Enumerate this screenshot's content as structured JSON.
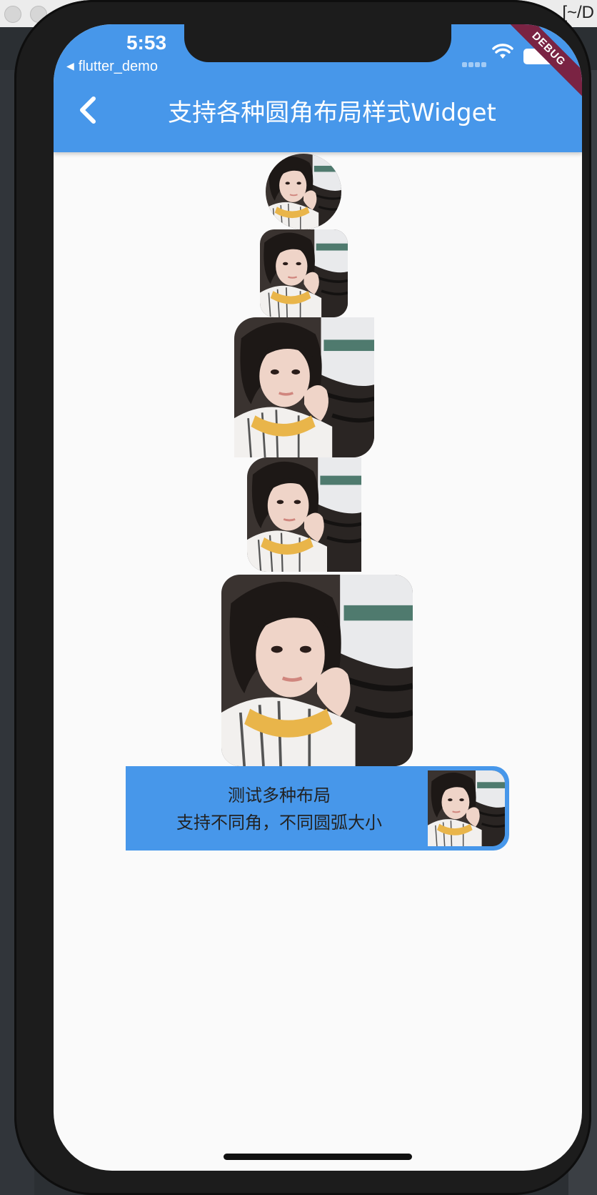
{
  "device": {
    "status_time": "5:53",
    "back_to_app": "flutter_demo",
    "debug_banner": "DEBUG"
  },
  "desktop": {
    "title_fragment": "[~/D"
  },
  "app_bar": {
    "title": "支持各种圆角布局样式Widget",
    "background": "#4797ea",
    "back_icon": "chevron-left-icon"
  },
  "photos": [
    {
      "shape": "circle"
    },
    {
      "shape": "rounded-all"
    },
    {
      "shape": "rounded-top-left-bottom-right"
    },
    {
      "shape": "rounded-left"
    },
    {
      "shape": "rounded-all-large"
    }
  ],
  "card": {
    "line1": "测试多种布局",
    "line2": "支持不同角，不同圆弧大小",
    "background": "#4797ea"
  }
}
